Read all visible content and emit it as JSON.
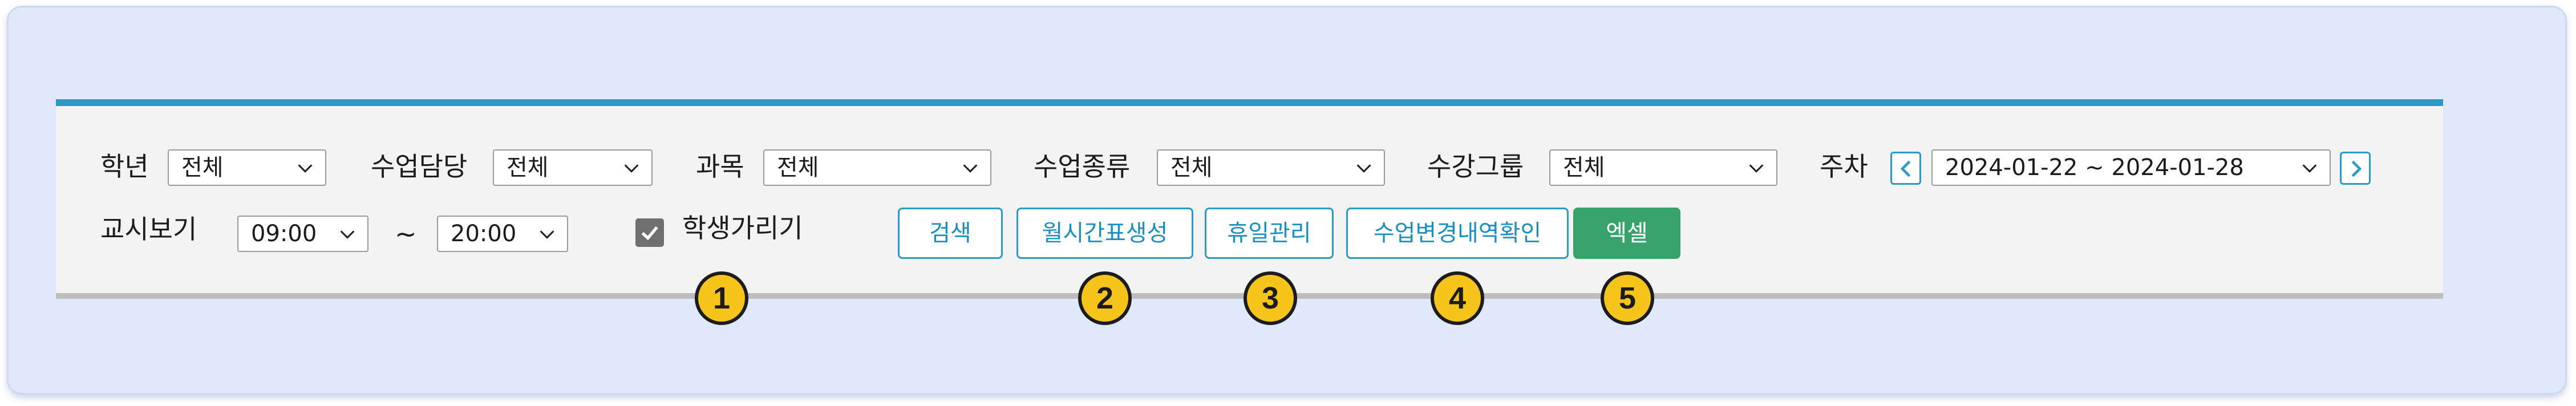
{
  "filters": {
    "grade": {
      "label": "학년",
      "value": "전체"
    },
    "teacher": {
      "label": "수업담당",
      "value": "전체"
    },
    "subject": {
      "label": "과목",
      "value": "전체"
    },
    "class_type": {
      "label": "수업종류",
      "value": "전체"
    },
    "course_group": {
      "label": "수강그룹",
      "value": "전체"
    },
    "week": {
      "label": "주차",
      "value": "2024-01-22 ~ 2024-01-28"
    }
  },
  "period_view": {
    "label": "교시보기",
    "start": "09:00",
    "separator": "~",
    "end": "20:00"
  },
  "hide_students": {
    "label": "학생가리기",
    "checked": true
  },
  "buttons": {
    "search": "검색",
    "generate_monthly": "월시간표생성",
    "holiday_manage": "휴일관리",
    "change_history": "수업변경내역확인",
    "excel": "엑셀"
  },
  "badges": [
    "1",
    "2",
    "3",
    "4",
    "5"
  ],
  "colors": {
    "accent": "#2b9ac4",
    "excel_button": "#37a26b",
    "badge": "#f6c51b",
    "frame_bg": "#dfe9fb",
    "panel_bg": "#f3f3f3"
  },
  "icons": {
    "dropdown": "chevron-down-icon",
    "prev_week": "chevron-left-icon",
    "next_week": "chevron-right-icon",
    "checkbox": "checkmark-icon"
  }
}
